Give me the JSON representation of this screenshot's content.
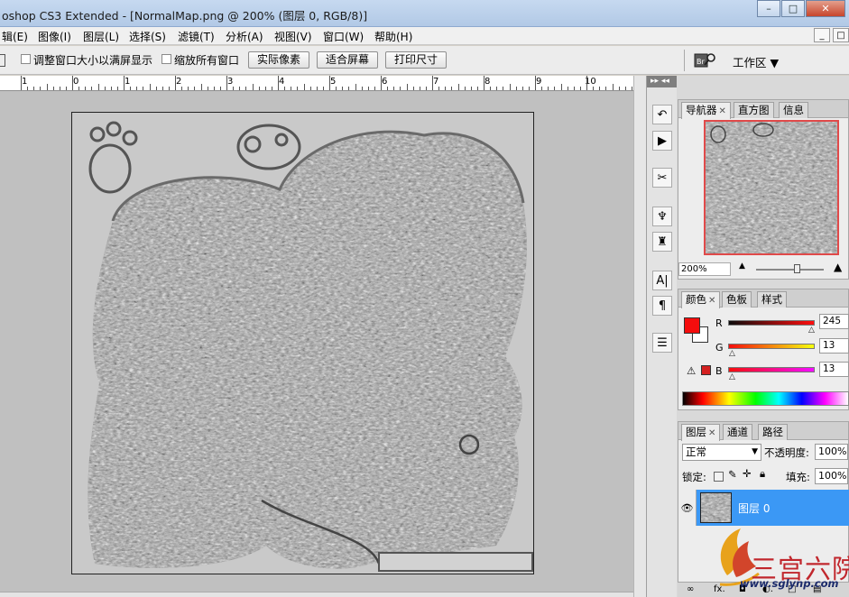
{
  "window": {
    "title": "oshop CS3 Extended - [NormalMap.png @ 200% (图层 0, RGB/8)]",
    "min_label": "–",
    "max_label": "□",
    "close_label": "✕"
  },
  "menu": {
    "items": [
      "辑(E)",
      "图像(I)",
      "图层(L)",
      "选择(S)",
      "滤镜(T)",
      "分析(A)",
      "视图(V)",
      "窗口(W)",
      "帮助(H)"
    ],
    "doc_controls": [
      "_",
      "□"
    ]
  },
  "options": {
    "check1_label": "调整窗口大小以满屏显示",
    "check2_label": "缩放所有窗口",
    "btn_actual": "实际像素",
    "btn_fit": "适合屏幕",
    "btn_print": "打印尺寸",
    "workspace_label": "工作区 ▼",
    "bridge_icon": "bridge-icon"
  },
  "ruler": {
    "labels": [
      "1",
      "0",
      "1",
      "2",
      "3",
      "4",
      "5",
      "6",
      "7",
      "8",
      "9",
      "10"
    ]
  },
  "toolcol": {
    "header": "▸▸ ◂◂",
    "icons": [
      "history-brush-icon",
      "play-icon",
      "tools-icon",
      "clone-stamp-icon",
      "stamp-icon",
      "text-icon",
      "paragraph-icon",
      "notes-icon"
    ],
    "glyphs": [
      "↶",
      "▶",
      "✂",
      "♆",
      "♜",
      "A|",
      "¶",
      "☰"
    ]
  },
  "navigator": {
    "tabs": [
      "导航器",
      "直方图",
      "信息"
    ],
    "zoom": "200%"
  },
  "color": {
    "tabs": [
      "颜色",
      "色板",
      "样式"
    ],
    "channels": [
      {
        "label": "R",
        "value": "245"
      },
      {
        "label": "G",
        "value": "13"
      },
      {
        "label": "B",
        "value": "13"
      }
    ],
    "fg": "#f50d0d",
    "warn_icon": "gamut-warning-icon"
  },
  "layers": {
    "tabs": [
      "图层",
      "通道",
      "路径"
    ],
    "blend_mode": "正常",
    "opacity_label": "不透明度:",
    "opacity_value": "100%",
    "lock_label": "锁定:",
    "fill_label": "填充:",
    "fill_value": "100%",
    "layer_name": "图层 0",
    "footer_icons": [
      "∞",
      "fx.",
      "◘",
      "◐.",
      "□",
      "▤"
    ]
  },
  "watermark": {
    "text": "三宫六院",
    "url": "www.sglynp.com"
  }
}
